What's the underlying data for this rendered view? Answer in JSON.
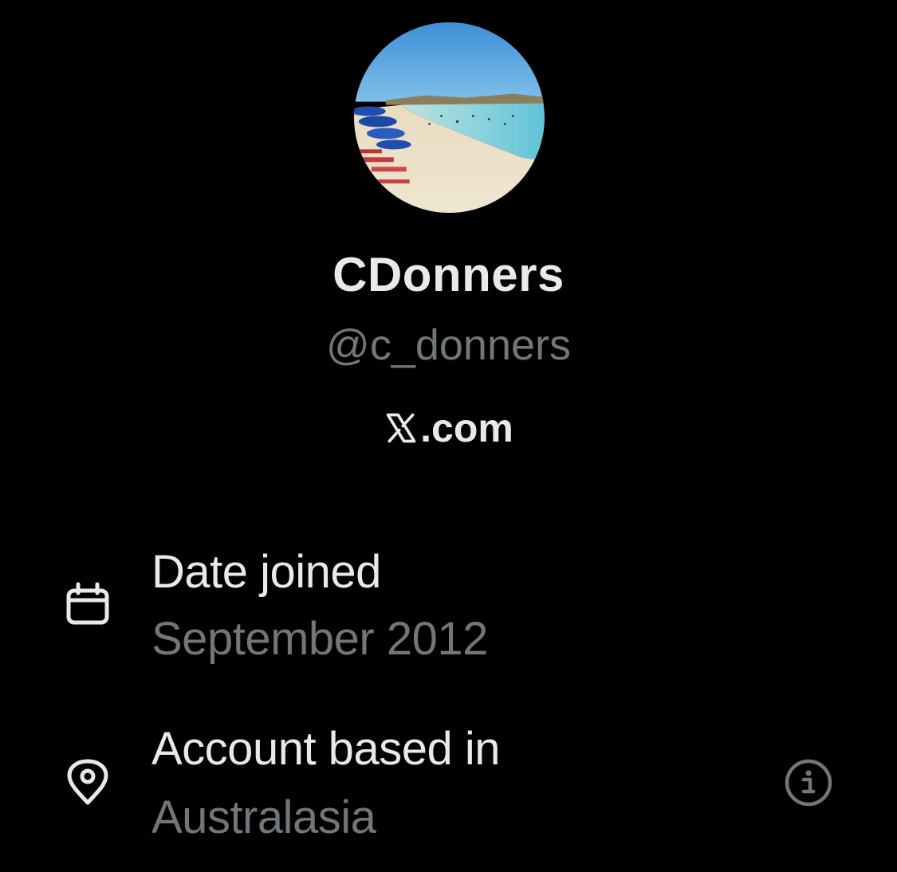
{
  "profile": {
    "display_name": "CDonners",
    "handle": "@c_donners",
    "brand_suffix": ".com",
    "avatar_description": "beach-photo"
  },
  "details": [
    {
      "icon": "calendar-icon",
      "label": "Date joined",
      "value": "September 2012"
    },
    {
      "icon": "location-pin-icon",
      "label": "Account based in",
      "value": "Australasia",
      "action_icon": "info-icon"
    }
  ],
  "colors": {
    "background": "#000000",
    "primary_text": "#e7e9ea",
    "secondary_text": "#71767b"
  }
}
